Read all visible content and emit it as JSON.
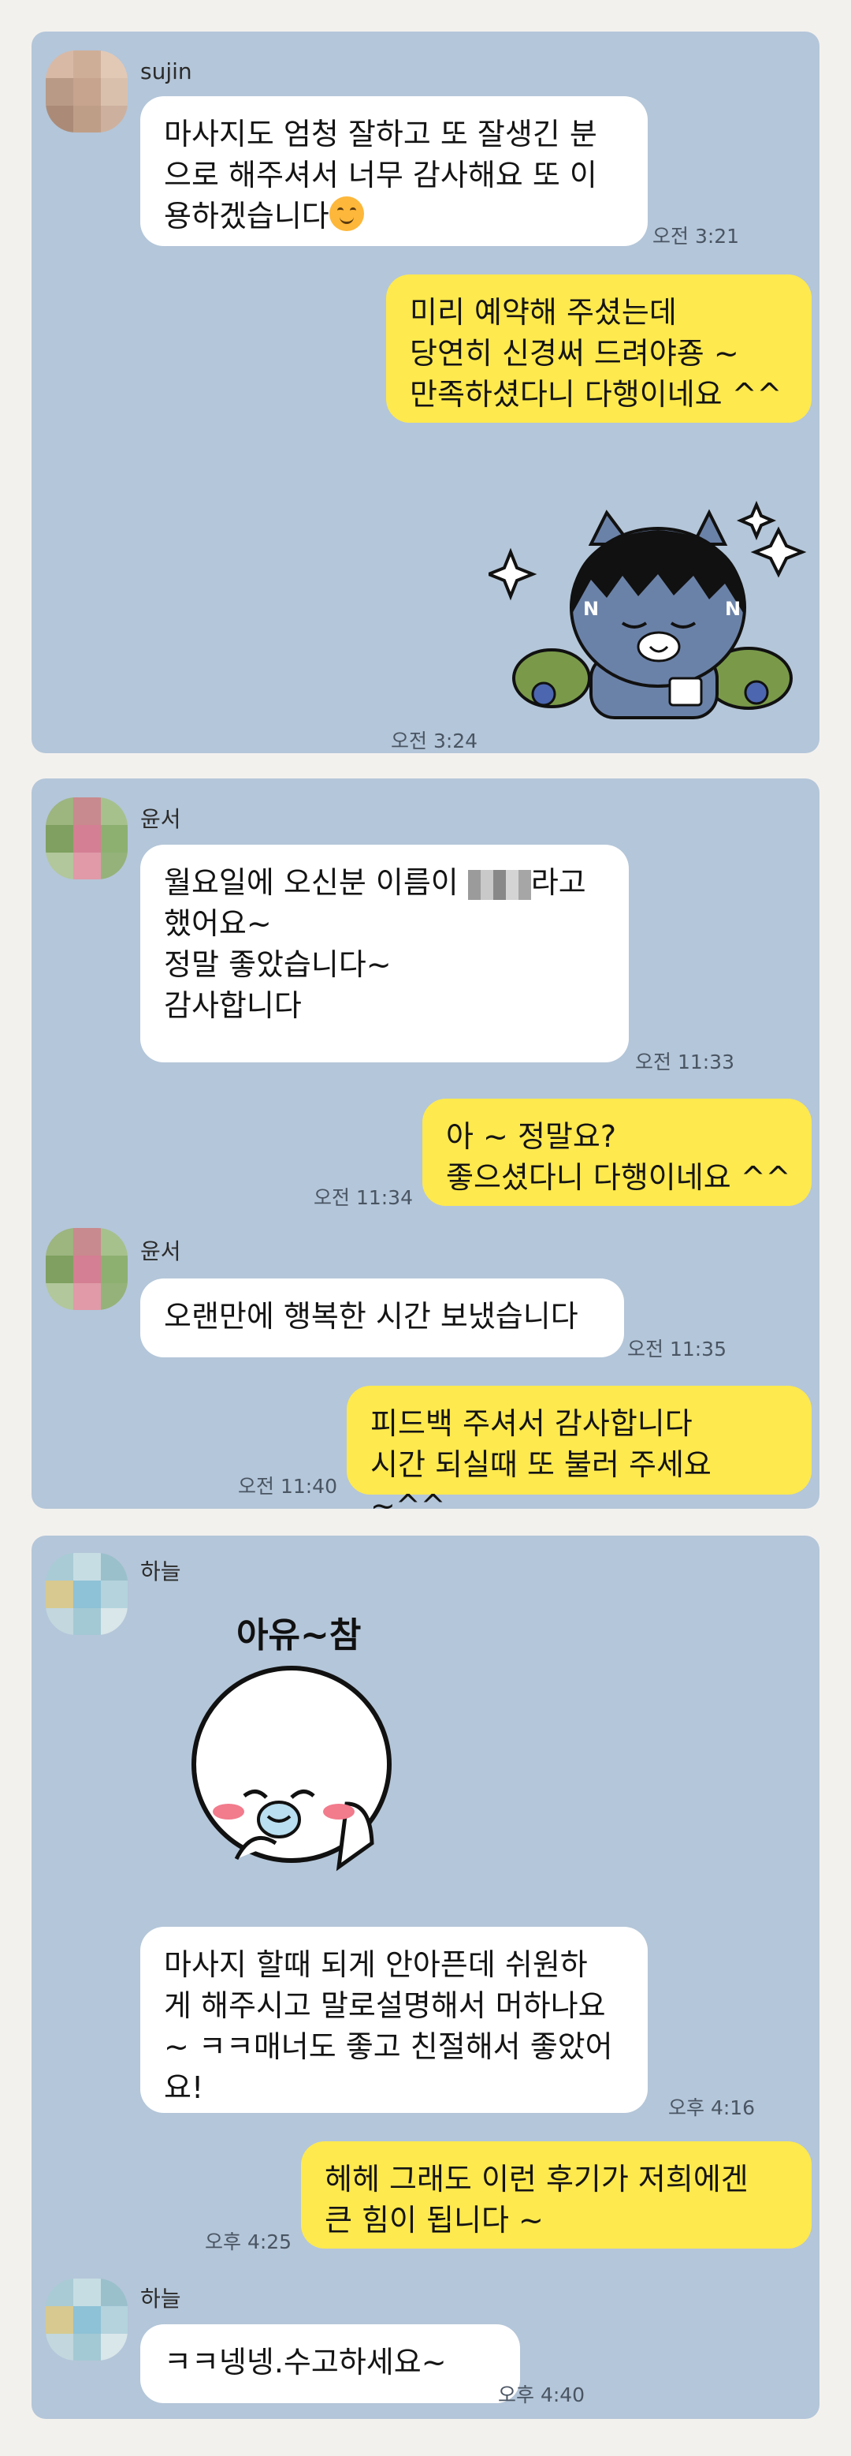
{
  "colors": {
    "background": "#f3f1ee",
    "panel": "#b4c6d9",
    "incoming_bubble": "#ffffff",
    "outgoing_bubble": "#fee94e"
  },
  "chats": [
    {
      "sender": "sujin",
      "messages": [
        {
          "text": "마사지도 엄청 잘하고 또 잘생긴 분\n으로 해주셔서 너무 감사해요 또 이\n용하겠습니다",
          "emoji": "smiling-face-icon",
          "time": "오전 3:21"
        },
        {
          "text": "미리 예약해 주셨는데\n당연히 신경써 드려야죵 ~\n만족하셨다니 다행이네요 ^^"
        },
        {
          "sticker": "cat-character-sticker",
          "time": "오전 3:24"
        }
      ]
    },
    {
      "sender": "윤서",
      "messages": [
        {
          "text_before": "월요일에 오신분 이름이 ",
          "text_after": "라고\n했어요~\n정말 좋았습니다~\n감사합니다",
          "time": "오전 11:33"
        },
        {
          "text": "아 ~ 정말요?\n좋으셨다니 다행이네요 ^^",
          "time": "오전 11:34"
        },
        {
          "sender": "윤서",
          "text": "오랜만에 행복한 시간 보냈습니다",
          "time": "오전 11:35"
        },
        {
          "text": "피드백 주셔서 감사합니다\n시간 되실때 또 불러 주세요 ~^^",
          "time": "오전 11:40"
        }
      ]
    },
    {
      "sender": "하늘",
      "messages": [
        {
          "sticker": "round-face-sticker",
          "caption": "아유~참"
        },
        {
          "text": "마사지 할때 되게 안아픈데 쉬원하\n게 해주시고 말로설명해서 머하나요\n~ ㅋㅋ매너도 좋고 친절해서 좋았어\n요!",
          "time": "오후 4:16"
        },
        {
          "text": "헤헤 그래도 이런 후기가 저희에겐\n큰 힘이 됩니다 ~",
          "time": "오후 4:25"
        },
        {
          "sender": "하늘",
          "text": "ㅋㅋ넹넹.수고하세요~",
          "time": "오후 4:40"
        }
      ]
    }
  ]
}
